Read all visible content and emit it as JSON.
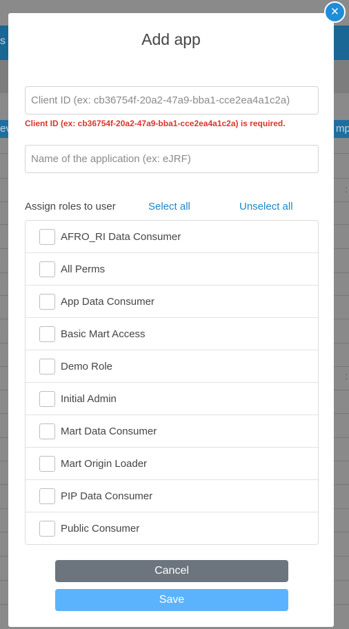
{
  "background": {
    "navbar_partial": "s",
    "table_head_left_partial": "ev",
    "table_head_right_partial": "mp",
    "row_glyph": ":"
  },
  "modal": {
    "title": "Add app",
    "close_icon": "×",
    "client_id": {
      "placeholder": "Client ID (ex: cb36754f-20a2-47a9-bba1-cce2ea4a1c2a)",
      "value": "",
      "error": "Client ID (ex: cb36754f-20a2-47a9-bba1-cce2ea4a1c2a) is required."
    },
    "app_name": {
      "placeholder": "Name of the application (ex: eJRF)",
      "value": ""
    },
    "roles": {
      "label": "Assign roles to user",
      "select_all": "Select all",
      "unselect_all": "Unselect all",
      "items": [
        {
          "label": "AFRO_RI Data Consumer",
          "checked": false
        },
        {
          "label": "All Perms",
          "checked": false
        },
        {
          "label": "App Data Consumer",
          "checked": false
        },
        {
          "label": "Basic Mart Access",
          "checked": false
        },
        {
          "label": "Demo Role",
          "checked": false
        },
        {
          "label": "Initial Admin",
          "checked": false
        },
        {
          "label": "Mart Data Consumer",
          "checked": false
        },
        {
          "label": "Mart Origin Loader",
          "checked": false
        },
        {
          "label": "PIP Data Consumer",
          "checked": false
        },
        {
          "label": "Public Consumer",
          "checked": false
        }
      ]
    },
    "buttons": {
      "cancel": "Cancel",
      "save": "Save"
    }
  },
  "colors": {
    "accent": "#1e86c8",
    "error": "#d9352a",
    "cancel": "#6c757d",
    "save": "#5cb3fd"
  }
}
